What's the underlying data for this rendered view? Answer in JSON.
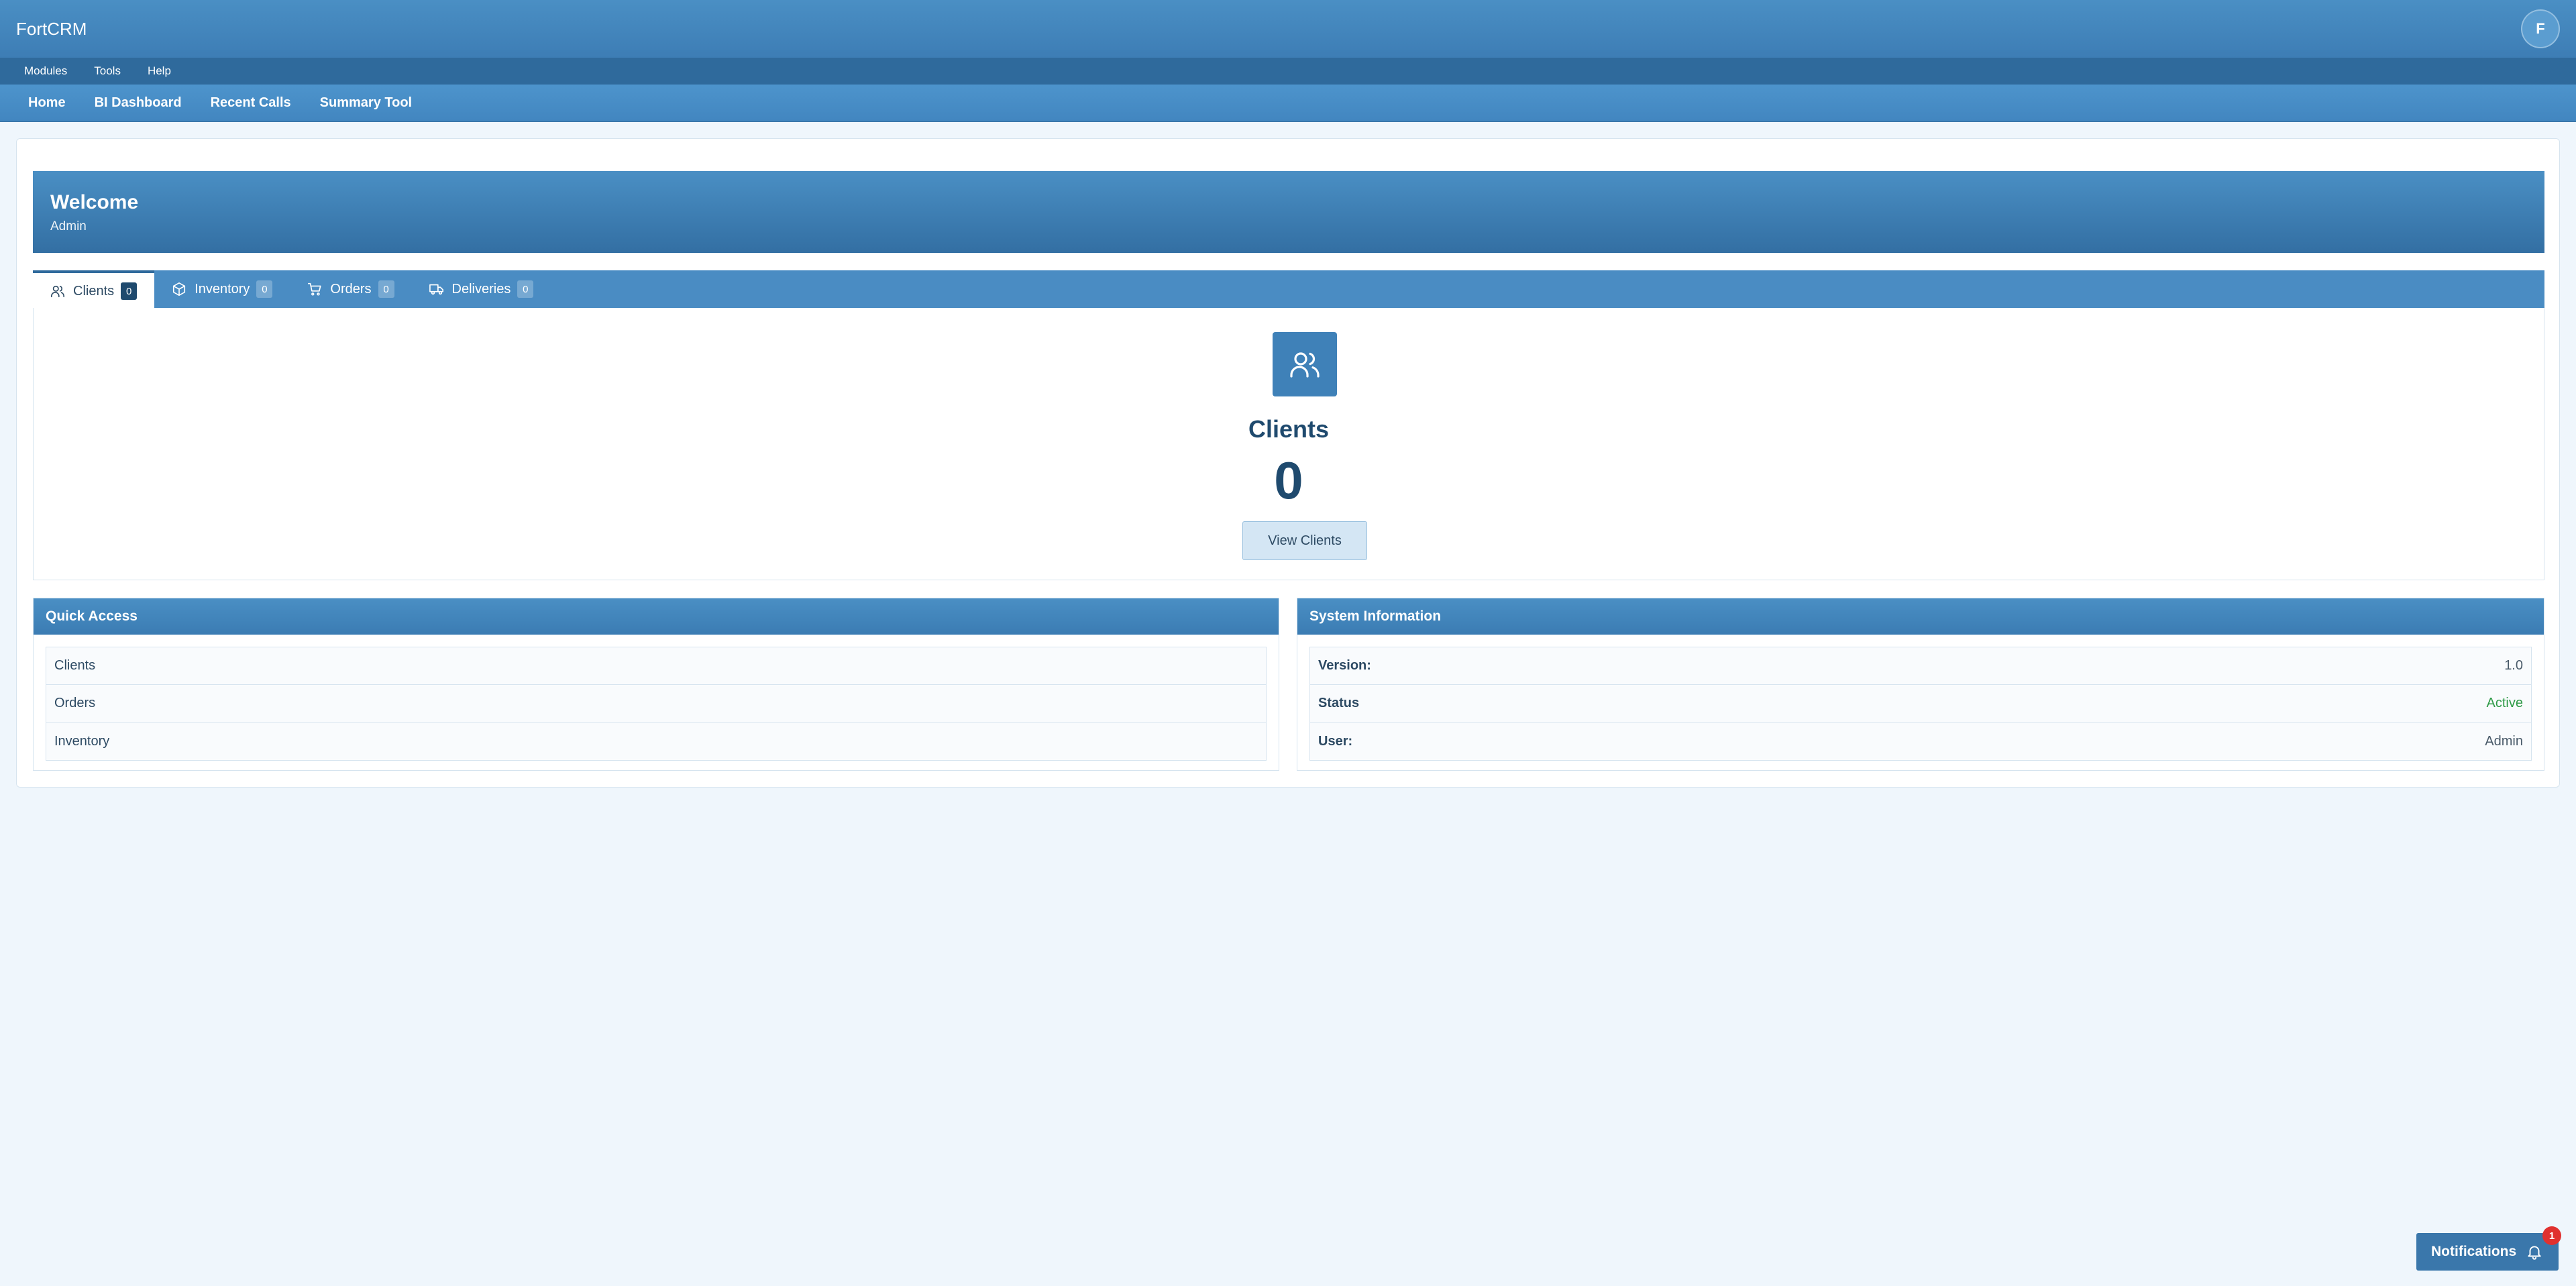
{
  "app": {
    "brand": "FortCRM",
    "avatar_initial": "F"
  },
  "menubar": {
    "items": [
      "Modules",
      "Tools",
      "Help"
    ]
  },
  "navbar": {
    "items": [
      "Home",
      "BI Dashboard",
      "Recent Calls",
      "Summary Tool"
    ]
  },
  "welcome": {
    "title": "Welcome",
    "subtitle": "Admin"
  },
  "tabs": [
    {
      "label": "Clients",
      "count": "0",
      "icon": "users-icon",
      "active": true
    },
    {
      "label": "Inventory",
      "count": "0",
      "icon": "box-icon",
      "active": false
    },
    {
      "label": "Orders",
      "count": "0",
      "icon": "cart-icon",
      "active": false
    },
    {
      "label": "Deliveries",
      "count": "0",
      "icon": "truck-icon",
      "active": false
    }
  ],
  "panel": {
    "icon": "users-icon",
    "title": "Clients",
    "count": "0",
    "button_label": "View Clients"
  },
  "quick_access": {
    "title": "Quick Access",
    "items": [
      "Clients",
      "Orders",
      "Inventory"
    ]
  },
  "system_info": {
    "title": "System Information",
    "rows": [
      {
        "label": "Version:",
        "value": "1.0"
      },
      {
        "label": "Status",
        "value": "Active"
      },
      {
        "label": "User:",
        "value": "Admin"
      }
    ]
  },
  "notifications": {
    "label": "Notifications",
    "count": "1"
  },
  "colors": {
    "primary": "#4a8fc4",
    "dark": "#1f4a6e",
    "background": "#eff6fc",
    "status_active": "#2e9a47",
    "badge_red": "#e0312f"
  }
}
